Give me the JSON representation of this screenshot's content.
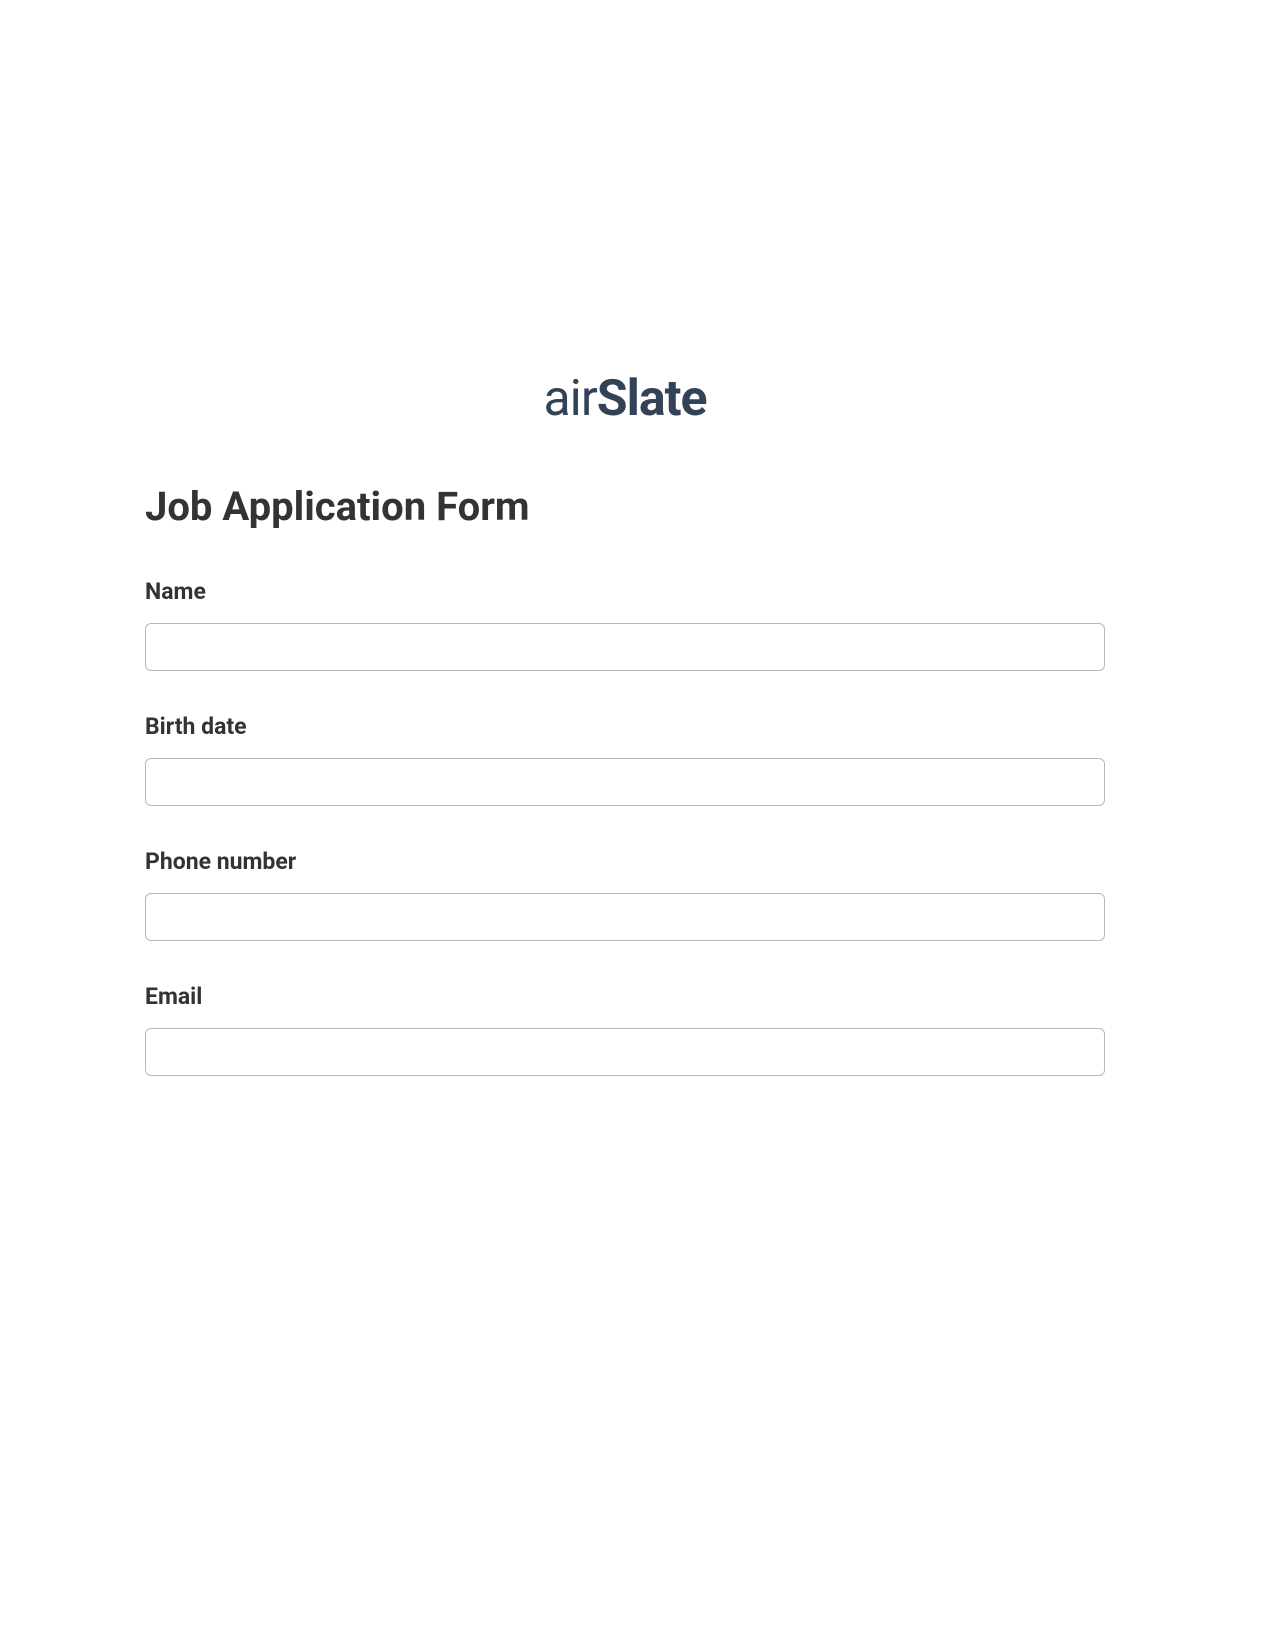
{
  "logo": {
    "prefix": "air",
    "suffix": "Slate"
  },
  "form": {
    "title": "Job Application Form",
    "fields": [
      {
        "label": "Name",
        "value": ""
      },
      {
        "label": "Birth date",
        "value": ""
      },
      {
        "label": "Phone number",
        "value": ""
      },
      {
        "label": "Email",
        "value": ""
      }
    ]
  }
}
